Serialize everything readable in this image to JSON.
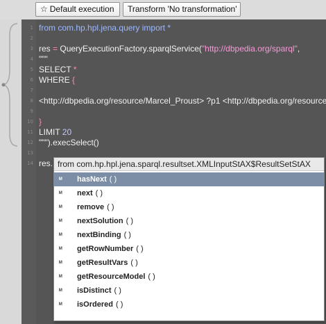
{
  "toolbar": {
    "default_execution_label": "Default execution",
    "default_execution_icon": "star-outline-icon",
    "transform_label": "Transform 'No transformation'"
  },
  "editor": {
    "lines": [
      {
        "num": "1",
        "parts": [
          {
            "t": "from com.hp.hpl.jena.query ",
            "c": "kw"
          },
          {
            "t": "import *",
            "c": "kw"
          }
        ]
      },
      {
        "num": "2",
        "parts": []
      },
      {
        "num": "3",
        "parts": [
          {
            "t": "res ",
            "c": ""
          },
          {
            "t": "=",
            "c": "pun"
          },
          {
            "t": " QueryExecutionFactory.sparqlService(",
            "c": ""
          },
          {
            "t": "\"http://dbpedia.org/sparql\"",
            "c": "str"
          },
          {
            "t": ",",
            "c": ""
          }
        ]
      },
      {
        "num": "4",
        "parts": [
          {
            "t": "\"\"\"",
            "c": ""
          }
        ]
      },
      {
        "num": "5",
        "parts": [
          {
            "t": "SELECT ",
            "c": ""
          },
          {
            "t": "*",
            "c": "pun"
          }
        ]
      },
      {
        "num": "6",
        "parts": [
          {
            "t": "WHERE ",
            "c": ""
          },
          {
            "t": "{",
            "c": "pun"
          }
        ]
      },
      {
        "num": "7",
        "parts": []
      },
      {
        "num": "8",
        "parts": [
          {
            "t": "<http://dbpedia.org/resource/Marcel_Proust> ?p1 <http://dbpedia.org/resource",
            "c": ""
          }
        ]
      },
      {
        "num": "9",
        "parts": []
      },
      {
        "num": "10",
        "parts": [
          {
            "t": "}",
            "c": "pun"
          }
        ]
      },
      {
        "num": "11",
        "parts": [
          {
            "t": "LIMIT ",
            "c": ""
          },
          {
            "t": "20",
            "c": "num"
          }
        ]
      },
      {
        "num": "12",
        "parts": [
          {
            "t": "\"\"\").execSelect()",
            "c": ""
          }
        ]
      },
      {
        "num": "13",
        "parts": []
      },
      {
        "num": "14",
        "parts": [
          {
            "t": "res.",
            "c": ""
          }
        ]
      }
    ]
  },
  "autocomplete": {
    "header": "from com.hp.hpl.jena.sparql.resultset.XMLInputStAX$ResultSetStAX",
    "method_icon": "method-icon",
    "items": [
      {
        "name": "hasNext",
        "args": "( )",
        "selected": true
      },
      {
        "name": "next",
        "args": "( )",
        "selected": false
      },
      {
        "name": "remove",
        "args": "( )",
        "selected": false
      },
      {
        "name": "nextSolution",
        "args": "( )",
        "selected": false
      },
      {
        "name": "nextBinding",
        "args": "( )",
        "selected": false
      },
      {
        "name": "getRowNumber",
        "args": "( )",
        "selected": false
      },
      {
        "name": "getResultVars",
        "args": "( )",
        "selected": false
      },
      {
        "name": "getResourceModel",
        "args": "( )",
        "selected": false
      },
      {
        "name": "isDistinct",
        "args": "( )",
        "selected": false
      },
      {
        "name": "isOrdered",
        "args": "( )",
        "selected": false
      }
    ]
  }
}
